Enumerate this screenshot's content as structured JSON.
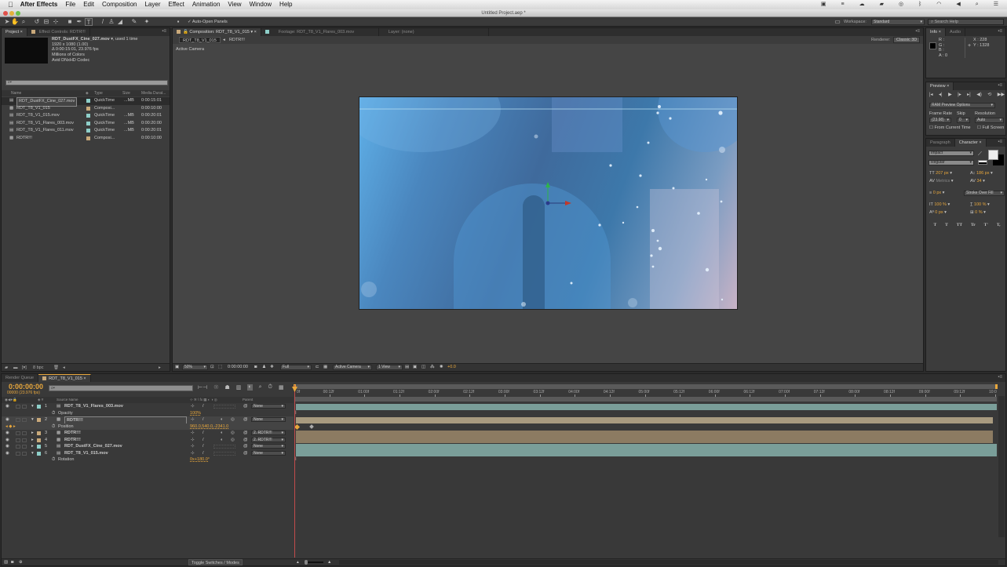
{
  "menubar": {
    "apple": "",
    "app_name": "After Effects",
    "items": [
      "File",
      "Edit",
      "Composition",
      "Layer",
      "Effect",
      "Animation",
      "View",
      "Window",
      "Help"
    ],
    "status_icons": [
      "camera-icon",
      "sliders-icon",
      "cloud-icon",
      "folder-icon",
      "lifebuoy-icon",
      "bluetooth-icon",
      "wifi-icon",
      "volume-icon",
      "search-icon",
      "list-icon"
    ]
  },
  "window": {
    "title": "Untitled Project.aep *"
  },
  "toolbar": {
    "tools": [
      "selection-tool",
      "hand-tool",
      "zoom-tool",
      "rotate-tool",
      "camera-tool",
      "pan-behind-tool",
      "rectangle-tool",
      "pen-tool",
      "type-tool",
      "brush-tool",
      "clone-stamp-tool",
      "eraser-tool",
      "roto-brush-tool",
      "puppet-pin-tool"
    ],
    "auto_open_panels": "Auto-Open Panels",
    "auto_open_checked": true,
    "workspace_label": "Workspace:",
    "workspace_value": "Standard",
    "search_placeholder": "Search Help"
  },
  "project": {
    "tabs": [
      "Project",
      "Effect Controls: RDTR!!!"
    ],
    "selected_info": {
      "name": "RDT_DustFX_Cine_027.mov",
      "usage": ", used 1 time",
      "dimensions": "1920 x 1080 (1.00)",
      "duration": "Δ 0:00:15:01, 23.976 fps",
      "colors": "Millions of Colors",
      "codec": "Avid DNxHD Codec"
    },
    "search_placeholder": "",
    "columns": [
      "Name",
      "Type",
      "Size",
      "Media Durat..."
    ],
    "items": [
      {
        "name": "RDT_DustFX_Cine_027.mov",
        "type": "QuickTime",
        "size": "...MB",
        "duration": "0:00:15:01",
        "kind": "footage",
        "label": "#8ecfc9",
        "selected": true
      },
      {
        "name": "RDT_T8_V1_015",
        "type": "Composi...",
        "size": "",
        "duration": "0:00:10:00",
        "kind": "comp",
        "label": "#c9a97a",
        "selected": false
      },
      {
        "name": "RDT_T8_V1_015.mov",
        "type": "QuickTime",
        "size": "...MB",
        "duration": "0:00:20:01",
        "kind": "footage",
        "label": "#8ecfc9",
        "selected": false
      },
      {
        "name": "RDT_T8_V1_Flares_003.mov",
        "type": "QuickTime",
        "size": "...MB",
        "duration": "0:00:20:00",
        "kind": "footage",
        "label": "#8ecfc9",
        "selected": false
      },
      {
        "name": "RDT_T8_V1_Flares_011.mov",
        "type": "QuickTime",
        "size": "...MB",
        "duration": "0:00:20:01",
        "kind": "footage",
        "label": "#8ecfc9",
        "selected": false
      },
      {
        "name": "RDTR!!!",
        "type": "Composi...",
        "size": "",
        "duration": "0:00:10:00",
        "kind": "comp",
        "label": "#c9a97a",
        "selected": false
      }
    ],
    "bit_depth": "8 bpc"
  },
  "composition": {
    "tabs": [
      "Composition: RDT_T8_V1_015",
      "Footage: RDT_T8_V1_Flares_003.mov",
      "Layer: (none)"
    ],
    "breadcrumbs": [
      "RDT_T8_V1_015",
      "RDTR!!!"
    ],
    "renderer_label": "Renderer:",
    "renderer_value": "Classic 3D",
    "view_label": "Active Camera",
    "footer": {
      "zoom": "50%",
      "timecode": "0:00:00:00",
      "resolution": "Full",
      "camera": "Active Camera",
      "views": "1 View",
      "exposure": "+0.0"
    }
  },
  "info": {
    "tabs": [
      "Info",
      "Audio"
    ],
    "r": "R :",
    "g": "G :",
    "b": "B :",
    "a": "A : 0",
    "x": "X : 228",
    "y": "Y : 1328"
  },
  "preview": {
    "tab": "Preview",
    "options": "RAM Preview Options",
    "frame_rate_label": "Frame Rate",
    "skip_label": "Skip",
    "resolution_label": "Resolution",
    "frame_rate_value": "(23.98)",
    "skip_value": "0",
    "resolution_value": "Auto",
    "from_current": "From Current Time",
    "full_screen": "Full Screen"
  },
  "character": {
    "tabs": [
      "Paragraph",
      "Character"
    ],
    "font": "Impact",
    "style": "Regular",
    "size": "207 px",
    "leading": "186 px",
    "kerning": "Metrics",
    "tracking": "34",
    "stroke_width": "0 px",
    "stroke_mode": "Stroke Over Fill",
    "vert_scale": "100 %",
    "horiz_scale": "100 %",
    "baseline": "0 px",
    "tsume": "0 %",
    "style_buttons": [
      "T",
      "T",
      "TT",
      "Tr",
      "T'",
      "T,"
    ]
  },
  "timeline": {
    "tabs": [
      "Render Queue",
      "RDT_T8_V1_015"
    ],
    "timecode": "0:00:00:00",
    "frame_info": "00000 (23.976 fps)",
    "columns": {
      "source": "Source Name",
      "parent": "Parent"
    },
    "layers": [
      {
        "index": "1",
        "name": "RDT_T8_V1_Flares_003.mov",
        "kind": "footage",
        "label": "#8ecfc9",
        "parent": "None",
        "expanded": true,
        "prop": {
          "name": "Opacity",
          "value": "100%"
        }
      },
      {
        "index": "2",
        "name": "RDTR!!!",
        "kind": "comp",
        "label": "#c9a97a",
        "parent": "None",
        "expanded": true,
        "selected": true,
        "prop": {
          "name": "Position",
          "value": "960.0,540.0,-2341.0"
        }
      },
      {
        "index": "3",
        "name": "RDTR!!!",
        "kind": "comp",
        "label": "#c9a97a",
        "parent": "2. RDTR!!!",
        "expanded": false
      },
      {
        "index": "4",
        "name": "RDTR!!!",
        "kind": "comp",
        "label": "#c9a97a",
        "parent": "2. RDTR!!!",
        "expanded": false
      },
      {
        "index": "5",
        "name": "RDT_DustFX_Cine_027.mov",
        "kind": "footage",
        "label": "#8ecfc9",
        "parent": "None",
        "expanded": false
      },
      {
        "index": "6",
        "name": "RDT_T8_V1_015.mov",
        "kind": "footage",
        "label": "#8ecfc9",
        "parent": "None",
        "expanded": true,
        "prop": {
          "name": "Rotation",
          "value": "0x+180.0°"
        }
      }
    ],
    "ruler": [
      "0f",
      "00:12f",
      "01:00f",
      "01:12f",
      "02:00f",
      "02:12f",
      "03:00f",
      "03:12f",
      "04:00f",
      "04:12f",
      "05:00f",
      "05:12f",
      "06:00f",
      "06:12f",
      "07:00f",
      "07:12f",
      "08:00f",
      "08:12f",
      "09:00f",
      "09:12f",
      "10:0"
    ],
    "toggle_label": "Toggle Switches / Modes"
  },
  "colors": {
    "accent": "#e8a73c",
    "footage_bar": "#7a9e99",
    "comp_bar": "#8c7b62",
    "playhead": "#c24b4b"
  }
}
